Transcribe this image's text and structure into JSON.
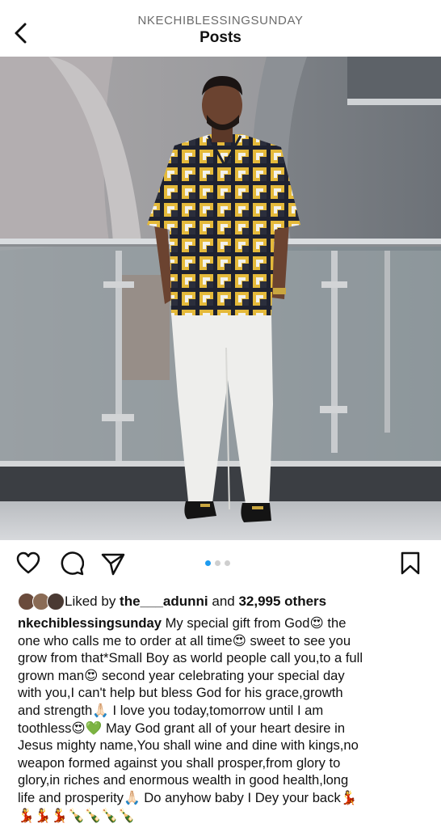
{
  "header": {
    "username": "NKECHIBLESSINGSUNDAY",
    "title": "Posts"
  },
  "post": {
    "image_alt": "Man in yellow and black patterned shirt and white trousers standing by a glass railing",
    "carousel": {
      "total": 3,
      "active": 1
    },
    "likes": {
      "prefix": "Liked by ",
      "liker": "the___adunni",
      "middle": " and ",
      "others": "32,995 others"
    },
    "caption": {
      "username": "nkechiblessingsunday",
      "lines": [
        " My special gift from God😍  the",
        "one who calls me to order at all time😍  sweet to see you",
        "grow from that*Small Boy as world people call you,to a full",
        "grown man😍  second year celebrating your special day",
        "with you,I can't help but bless God for his grace,growth",
        "and strength🙏🏻  I love you today,tomorrow until I am",
        "toothless😍💚  May God grant all of your heart desire in",
        "Jesus mighty name,You shall wine and dine with kings,no",
        "weapon formed against you shall prosper,from glory to",
        "glory,in riches and enormous wealth in good health,long",
        "life and prosperity🙏🏻  Do anyhow baby I Dey your back💃",
        "💃💃💃🍾🍾🍾🍾"
      ]
    }
  },
  "icons": {
    "back": "chevron-left-icon",
    "like": "heart-icon",
    "comment": "comment-bubble-icon",
    "share": "paper-plane-icon",
    "save": "bookmark-icon"
  },
  "colors": {
    "accent_dot": "#1d9bf0",
    "username_header": "#6b6b6b"
  }
}
